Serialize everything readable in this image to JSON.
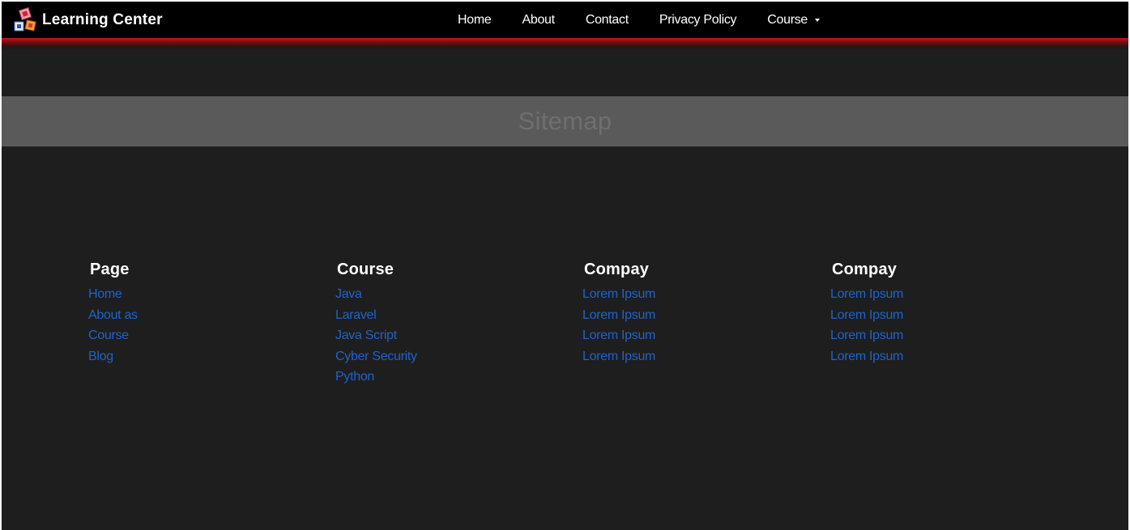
{
  "brand": {
    "name": "Learning Center",
    "logo_icon": "abc-blocks-icon"
  },
  "nav": {
    "items": [
      {
        "label": "Home"
      },
      {
        "label": "About"
      },
      {
        "label": "Contact"
      },
      {
        "label": "Privacy Policy"
      },
      {
        "label": "Course",
        "dropdown": true
      }
    ]
  },
  "colors": {
    "nav_background": "#000000",
    "accent_red": "#c8151b",
    "page_background": "#1e1e1e",
    "band_background": "#5a5a5a",
    "link_color": "#1f63c9"
  },
  "banner": {
    "title": "Sitemap"
  },
  "columns": [
    {
      "heading": "Page",
      "links": [
        "Home",
        "About as",
        "Course",
        "Blog"
      ]
    },
    {
      "heading": "Course",
      "links": [
        "Java",
        "Laravel",
        "Java Script",
        "Cyber Security",
        "Python"
      ]
    },
    {
      "heading": "Compay",
      "links": [
        "Lorem Ipsum",
        "Lorem Ipsum",
        "Lorem Ipsum",
        "Lorem Ipsum"
      ]
    },
    {
      "heading": "Compay",
      "links": [
        "Lorem Ipsum",
        "Lorem Ipsum",
        "Lorem Ipsum",
        "Lorem Ipsum"
      ]
    }
  ]
}
